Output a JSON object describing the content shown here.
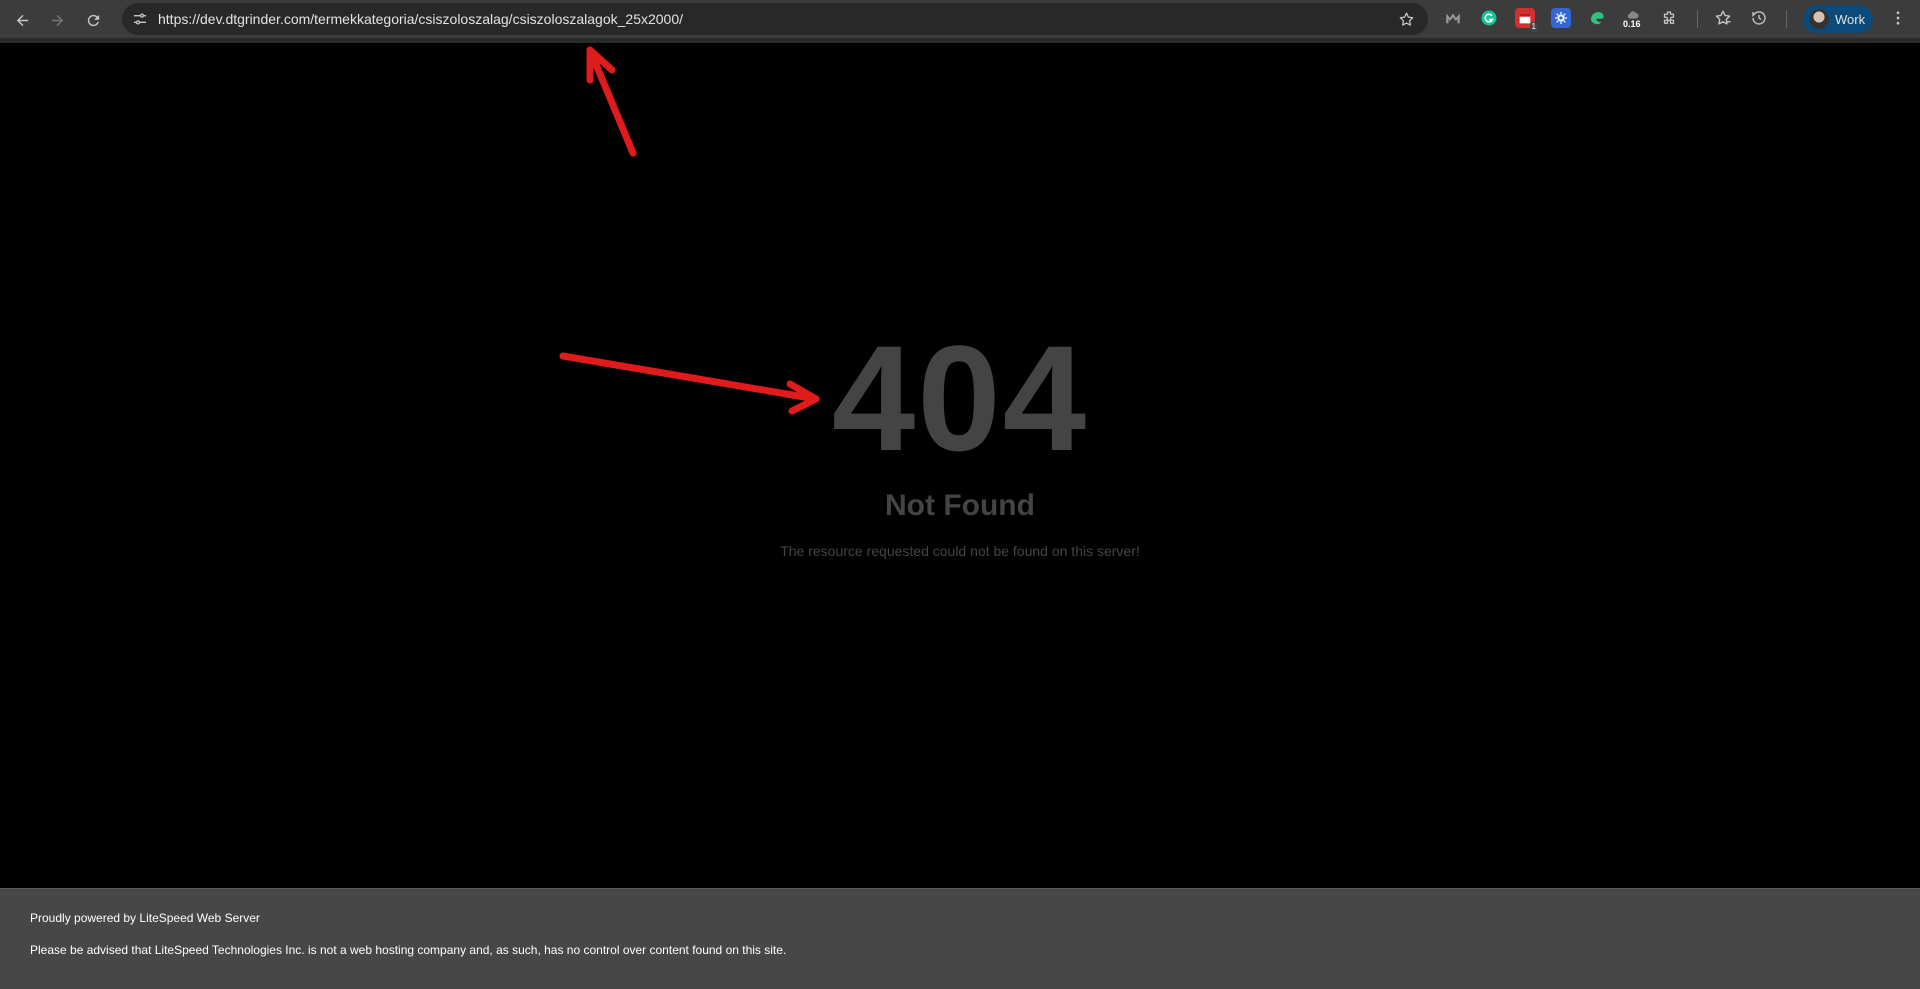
{
  "browser": {
    "url": "https://dev.dtgrinder.com/termekkategoria/csiszoloszalag/csiszoloszalagok_25x2000/",
    "extensions": {
      "calendar_badge": "1",
      "speed_value": "0.16"
    },
    "profile_label": "Work"
  },
  "page": {
    "error_code": "404",
    "error_title": "Not Found",
    "error_message": "The resource requested could not be found on this server!"
  },
  "footer": {
    "powered_by": "Proudly powered by LiteSpeed Web Server",
    "disclaimer": "Please be advised that LiteSpeed Technologies Inc. is not a web hosting company and, as such, has no control over content found on this site."
  },
  "colors": {
    "annotation_arrow": "#e01b1b",
    "toolbar": "#3c3c3c",
    "page_background": "#000000",
    "error_text": "#444444",
    "footer_background": "#474747"
  }
}
